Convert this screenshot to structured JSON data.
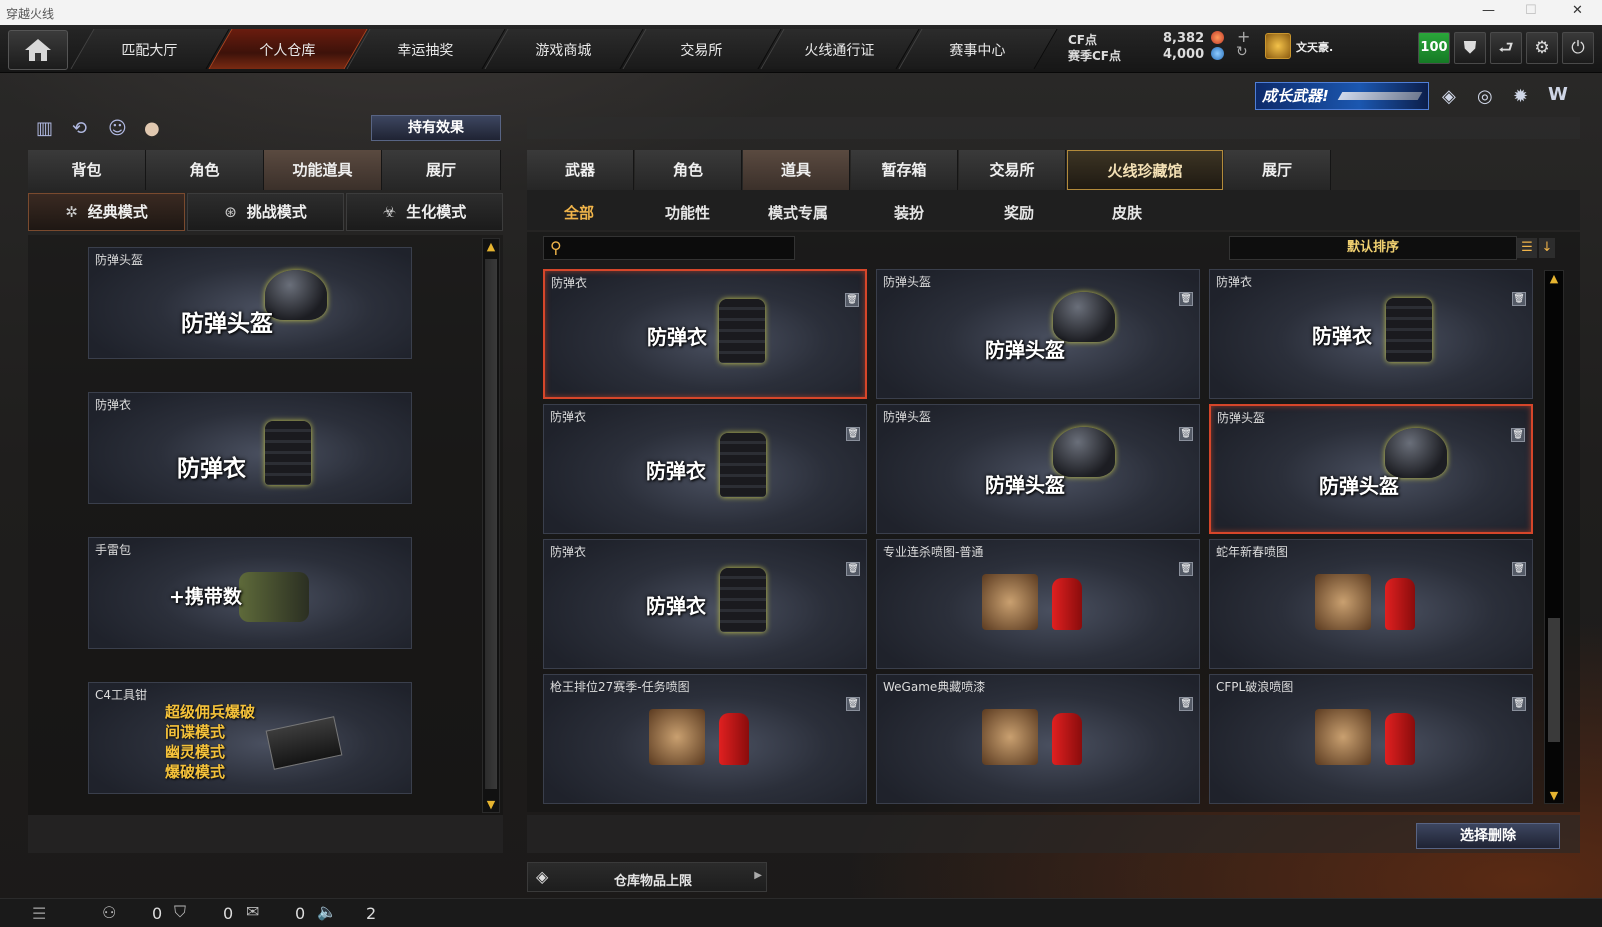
{
  "window": {
    "title": "穿越火线"
  },
  "nav": {
    "tabs": [
      "匹配大厅",
      "个人仓库",
      "幸运抽奖",
      "游戏商城",
      "交易所",
      "火线通行证",
      "赛事中心"
    ],
    "active_index": 1
  },
  "currency": {
    "cf_label": "CF点",
    "cf_value": "8,382",
    "season_label": "赛季CF点",
    "season_value": "4,000"
  },
  "user": {
    "name": "文天豪.",
    "level": "100"
  },
  "banner": {
    "text": "成长武器!"
  },
  "left": {
    "effects_button": "持有效果",
    "tabs": [
      "背包",
      "角色",
      "功能道具",
      "展厅"
    ],
    "active_tab": 2,
    "modes": [
      "经典模式",
      "挑战模式",
      "生化模式"
    ],
    "active_mode": 0,
    "items": [
      {
        "label": "防弹头盔",
        "title": "防弹头盔",
        "icon": "helmet-icon"
      },
      {
        "label": "防弹衣",
        "title": "防弹衣",
        "icon": "vest-icon"
      },
      {
        "label": "手雷包",
        "title": "+携带数",
        "icon": "grenade-pack-icon"
      },
      {
        "label": "C4工具钳",
        "lines": [
          "超级佣兵爆破",
          "间谍模式",
          "幽灵模式",
          "爆破模式"
        ],
        "icon": "c4-toolkit-icon"
      }
    ]
  },
  "right": {
    "tabs": [
      "武器",
      "角色",
      "道具",
      "暂存箱",
      "交易所",
      "火线珍藏馆",
      "展厅"
    ],
    "active_tab": 2,
    "gold_tab": 5,
    "subtabs": [
      "全部",
      "功能性",
      "模式专属",
      "装扮",
      "奖励",
      "皮肤"
    ],
    "active_subtab": 0,
    "search": {
      "placeholder": ""
    },
    "sort": {
      "label": "默认排序"
    },
    "items": [
      {
        "label": "防弹衣",
        "title": "防弹衣",
        "kind": "vest",
        "selected": true
      },
      {
        "label": "防弹头盔",
        "title": "防弹头盔",
        "kind": "helmet",
        "selected": false
      },
      {
        "label": "防弹衣",
        "title": "防弹衣",
        "kind": "vest",
        "selected": false
      },
      {
        "label": "防弹衣",
        "title": "防弹衣",
        "kind": "vest",
        "selected": false
      },
      {
        "label": "防弹头盔",
        "title": "防弹头盔",
        "kind": "helmet",
        "selected": false
      },
      {
        "label": "防弹头盔",
        "title": "防弹头盔",
        "kind": "helmet",
        "selected": true
      },
      {
        "label": "防弹衣",
        "title": "防弹衣",
        "kind": "vest",
        "selected": false
      },
      {
        "label": "专业连杀喷图-普通",
        "title": "",
        "kind": "spray",
        "selected": false
      },
      {
        "label": "蛇年新春喷图",
        "title": "",
        "kind": "spray",
        "selected": false
      },
      {
        "label": "枪王排位27赛季-任务喷图",
        "title": "",
        "kind": "spray",
        "selected": false
      },
      {
        "label": "WeGame典藏喷漆",
        "title": "",
        "kind": "spray",
        "selected": false
      },
      {
        "label": "CFPL破浪喷图",
        "title": "",
        "kind": "spray",
        "selected": false
      }
    ],
    "delete_button": "选择删除",
    "capacity": {
      "label": "仓库物品上限"
    }
  },
  "status": {
    "counts": [
      "0",
      "0",
      "0",
      "2"
    ]
  },
  "colors": {
    "accent_red": "#d6462a",
    "gold": "#f0b44a",
    "green": "#2aa63a"
  }
}
